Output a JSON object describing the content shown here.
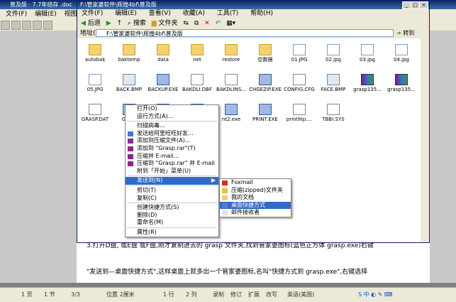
{
  "word": {
    "title": "普及版 · 7.7年结存 .doc",
    "menu": [
      "文件(F)",
      "编辑(E)",
      "视图"
    ],
    "doc_lines": [
      "3.打开D盘, 或E盘 或F盘,刚才复制进去的 grasp 文件夹,找到管家婆图标(蓝色正方体 grasp.exe)右键",
      "\"发送到—桌面快捷方式\",这样桌面上就多出一个管家婆图标,名叫\"快捷方式到 grasp.exe\",右键选择"
    ],
    "status": {
      "page": "1 页",
      "section": "1 节",
      "pages": "3/3",
      "position": "位置 2厘米",
      "line": "1 行",
      "col": "2 列",
      "rec": "录制",
      "rev": "修订",
      "ext": "扩展",
      "ovr": "改写",
      "lang": "英语(美国)"
    }
  },
  "explorer": {
    "title": "F:\\管家婆软件\\辉煌4bf\\普及版",
    "menu": [
      "文件(F)",
      "编辑(E)",
      "查看(V)",
      "收藏(A)",
      "工具(T)",
      "帮助(H)"
    ],
    "toolbar": {
      "back": "后退",
      "search": "搜索",
      "folders": "文件夹"
    },
    "address_label": "地址(D)",
    "address_value": "F:\\管家婆软件\\辉煌4bf\\普及版",
    "go_label": "转到",
    "files": [
      {
        "name": "autobak",
        "type": "folder"
      },
      {
        "name": "baktemp",
        "type": "folder"
      },
      {
        "name": "data",
        "type": "folder"
      },
      {
        "name": "net",
        "type": "folder"
      },
      {
        "name": "restore",
        "type": "folder"
      },
      {
        "name": "空数据",
        "type": "folder"
      },
      {
        "name": "01.JPG",
        "type": "jpg"
      },
      {
        "name": "02.jpg",
        "type": "jpg"
      },
      {
        "name": "03.jpg",
        "type": "jpg"
      },
      {
        "name": "04.jpg",
        "type": "jpg"
      },
      {
        "name": "05.JPG",
        "type": "jpg"
      },
      {
        "name": "BACK.BMP",
        "type": "bmp"
      },
      {
        "name": "BACKUP.EXE",
        "type": "exe"
      },
      {
        "name": "BAKDLI.DBF",
        "type": "txt"
      },
      {
        "name": "BAKDLINS...",
        "type": "txt"
      },
      {
        "name": "CHGEZIP.EXE",
        "type": "exe"
      },
      {
        "name": "CONFIG.CFG",
        "type": "txt"
      },
      {
        "name": "FACE.BMP",
        "type": "bmp"
      },
      {
        "name": "grasp135...",
        "type": "rar"
      },
      {
        "name": "grasp135...",
        "type": "rar"
      },
      {
        "name": "GRASP.DAT",
        "type": "txt"
      },
      {
        "name": "Grasp",
        "type": "exe"
      },
      {
        "name": "",
        "type": "exe"
      },
      {
        "name": "",
        "type": "exe"
      },
      {
        "name": "nt2.exe",
        "type": "exe"
      },
      {
        "name": "PRINT.EXE",
        "type": "exe"
      },
      {
        "name": "printhlp....",
        "type": "txt"
      },
      {
        "name": "TBBI.SYS",
        "type": "txt"
      }
    ]
  },
  "context_menu": [
    {
      "label": "打开(O)"
    },
    {
      "label": "运行方式(A)..."
    },
    {
      "sep": true
    },
    {
      "label": "扫描病毒..."
    },
    {
      "label": "发送给阿里旺旺好友..."
    },
    {
      "label": "添加到压缩文件(A)..."
    },
    {
      "label": "添加到 \"Grasp.rar\"(T)"
    },
    {
      "label": "压缩并 E-mail..."
    },
    {
      "label": "压缩到 \"Grasp.rar\" 并 E-mail"
    },
    {
      "label": "附到「开始」菜单(U)"
    },
    {
      "sep": true
    },
    {
      "label": "发送到(N)",
      "highlight": true,
      "submenu": true
    },
    {
      "sep": true
    },
    {
      "label": "剪切(T)"
    },
    {
      "label": "复制(C)"
    },
    {
      "sep": true
    },
    {
      "label": "创建快捷方式(S)"
    },
    {
      "label": "删除(D)"
    },
    {
      "label": "重命名(M)"
    },
    {
      "sep": true
    },
    {
      "label": "属性(R)"
    }
  ],
  "send_to_menu": [
    {
      "label": "Foxmail"
    },
    {
      "label": "压缩(zipped)文件夹"
    },
    {
      "label": "我的文档"
    },
    {
      "label": "桌面快捷方式",
      "highlight": true
    },
    {
      "label": "邮件接收者"
    }
  ],
  "colors": {
    "highlight": "#316ac5",
    "titlebar": "#0a246a",
    "face": "#ece9d8"
  }
}
